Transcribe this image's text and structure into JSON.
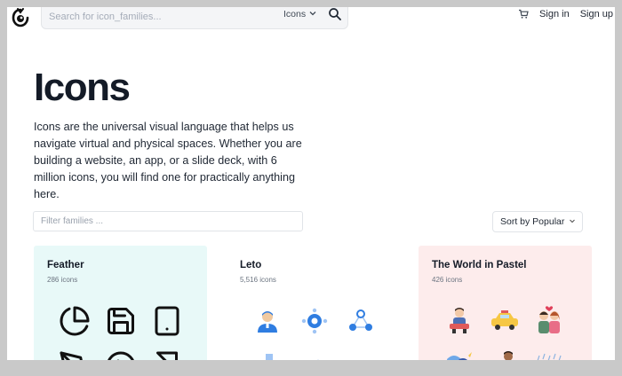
{
  "header": {
    "search_placeholder": "Search for icon_families...",
    "search_scope": "Icons",
    "sign_in": "Sign in",
    "sign_up": "Sign up"
  },
  "hero": {
    "title": "Icons",
    "description": "Icons are the universal visual language that helps us navigate virtual and physical spaces. Whether you are building a website, an app, or a slide deck, with 6 million icons, you will find one for practically anything here."
  },
  "filter": {
    "placeholder": "Filter families ...",
    "sort_label": "Sort by Popular"
  },
  "cards": [
    {
      "name": "Feather",
      "count": "286 icons",
      "bg": "#e8f9f8"
    },
    {
      "name": "Leto",
      "count": "5,516 icons",
      "bg": "#ffffff"
    },
    {
      "name": "The World in Pastel",
      "count": "426 icons",
      "bg": "#fdecec"
    }
  ],
  "colors": {
    "accent_blue": "#2f7de1",
    "text_dark": "#141b27"
  }
}
